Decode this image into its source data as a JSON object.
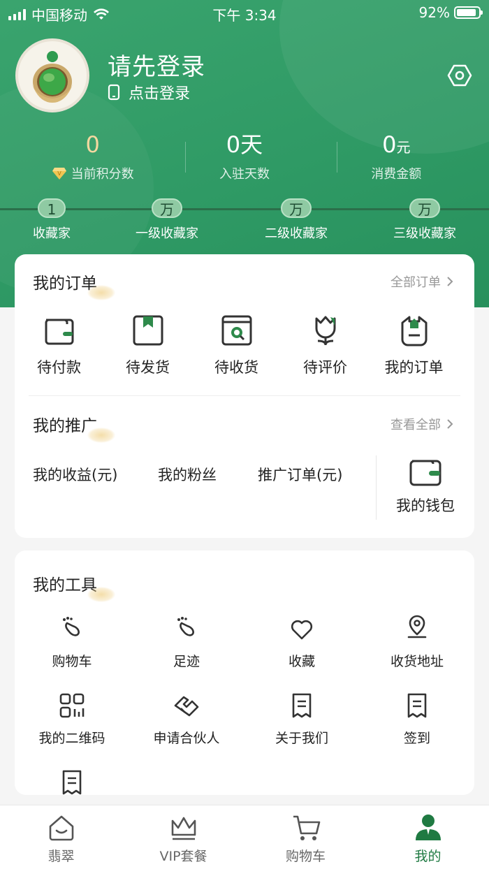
{
  "status_bar": {
    "carrier": "中国移动",
    "time": "下午 3:34",
    "battery": "92%"
  },
  "profile": {
    "title": "请先登录",
    "subtitle": "点击登录"
  },
  "stats": [
    {
      "value": "0",
      "unit": "",
      "label": "当前积分数"
    },
    {
      "value": "0",
      "unit": "天",
      "label": "入驻天数"
    },
    {
      "value": "0",
      "unit": "元",
      "label": "消费金额"
    }
  ],
  "levels": [
    {
      "badge": "1",
      "name": "收藏家"
    },
    {
      "badge": "万",
      "name": "一级收藏家"
    },
    {
      "badge": "万",
      "name": "二级收藏家"
    },
    {
      "badge": "万",
      "name": "三级收藏家"
    }
  ],
  "orders": {
    "title": "我的订单",
    "more": "全部订单",
    "items": [
      "待付款",
      "待发货",
      "待收货",
      "待评价",
      "我的订单"
    ]
  },
  "promotion": {
    "title": "我的推广",
    "more": "查看全部",
    "items": [
      "我的收益(元)",
      "我的粉丝",
      "推广订单(元)"
    ],
    "wallet": "我的钱包"
  },
  "tools": {
    "title": "我的工具",
    "items": [
      "购物车",
      "足迹",
      "收藏",
      "收货地址",
      "我的二维码",
      "申请合伙人",
      "关于我们",
      "签到"
    ]
  },
  "tabbar": {
    "items": [
      "翡翠",
      "VIP套餐",
      "购物车",
      "我的"
    ],
    "active_color": "#1f7a42"
  },
  "colors": {
    "brand_green": "#2f9a65",
    "gold": "#f3d8a0"
  }
}
